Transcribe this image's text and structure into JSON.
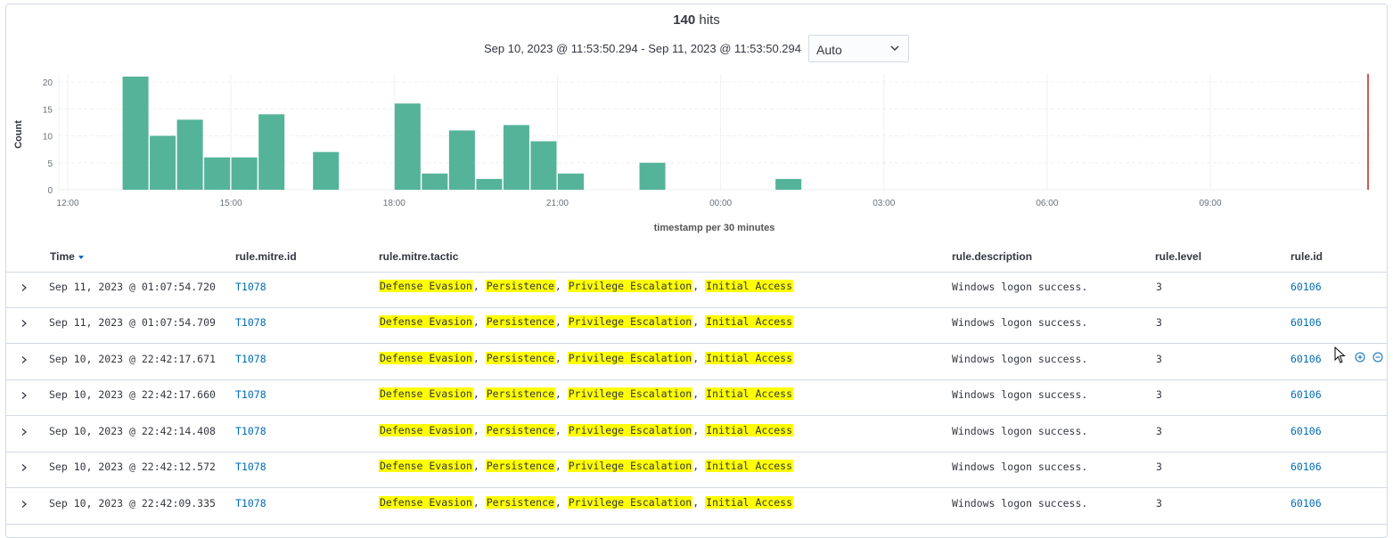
{
  "summary": {
    "hits_count": "140",
    "hits_label": "hits"
  },
  "time_range": "Sep 10, 2023 @ 11:53:50.294 - Sep 11, 2023 @ 11:53:50.294",
  "interval_select": {
    "value": "Auto"
  },
  "chart_data": {
    "type": "bar",
    "ylabel": "Count",
    "xlabel": "timestamp per 30 minutes",
    "ylim": [
      0,
      21
    ],
    "yticks": [
      0,
      5,
      10,
      15,
      20
    ],
    "xticks": [
      "12:00",
      "15:00",
      "18:00",
      "21:00",
      "00:00",
      "03:00",
      "06:00",
      "09:00"
    ],
    "x_start": "Sep 10, 2023 12:00",
    "bucket_minutes": 30,
    "bars": [
      {
        "start": "13:00",
        "value": 21
      },
      {
        "start": "13:30",
        "value": 10
      },
      {
        "start": "14:00",
        "value": 13
      },
      {
        "start": "14:30",
        "value": 6
      },
      {
        "start": "15:00",
        "value": 6
      },
      {
        "start": "15:30",
        "value": 14
      },
      {
        "start": "16:30",
        "value": 7
      },
      {
        "start": "18:00",
        "value": 16
      },
      {
        "start": "18:30",
        "value": 3
      },
      {
        "start": "19:00",
        "value": 11
      },
      {
        "start": "19:30",
        "value": 2
      },
      {
        "start": "20:00",
        "value": 12
      },
      {
        "start": "20:30",
        "value": 9
      },
      {
        "start": "21:00",
        "value": 3
      },
      {
        "start": "22:30",
        "value": 5
      },
      {
        "start": "01:00",
        "value": 2
      }
    ],
    "bar_color": "#54b399",
    "current_time_marker_color": "#bd271e",
    "grid": true
  },
  "table": {
    "columns": [
      "Time",
      "rule.mitre.id",
      "rule.mitre.tactic",
      "rule.description",
      "rule.level",
      "rule.id"
    ],
    "rows": [
      {
        "time": "Sep 11, 2023 @ 01:07:54.720",
        "mitre_id": "T1078",
        "tactics": [
          "Defense Evasion",
          "Persistence",
          "Privilege Escalation",
          "Initial Access"
        ],
        "description": "Windows logon success.",
        "level": "3",
        "rule_id": "60106"
      },
      {
        "time": "Sep 11, 2023 @ 01:07:54.709",
        "mitre_id": "T1078",
        "tactics": [
          "Defense Evasion",
          "Persistence",
          "Privilege Escalation",
          "Initial Access"
        ],
        "description": "Windows logon success.",
        "level": "3",
        "rule_id": "60106"
      },
      {
        "time": "Sep 10, 2023 @ 22:42:17.671",
        "mitre_id": "T1078",
        "tactics": [
          "Defense Evasion",
          "Persistence",
          "Privilege Escalation",
          "Initial Access"
        ],
        "description": "Windows logon success.",
        "level": "3",
        "rule_id": "60106"
      },
      {
        "time": "Sep 10, 2023 @ 22:42:17.660",
        "mitre_id": "T1078",
        "tactics": [
          "Defense Evasion",
          "Persistence",
          "Privilege Escalation",
          "Initial Access"
        ],
        "description": "Windows logon success.",
        "level": "3",
        "rule_id": "60106"
      },
      {
        "time": "Sep 10, 2023 @ 22:42:14.408",
        "mitre_id": "T1078",
        "tactics": [
          "Defense Evasion",
          "Persistence",
          "Privilege Escalation",
          "Initial Access"
        ],
        "description": "Windows logon success.",
        "level": "3",
        "rule_id": "60106"
      },
      {
        "time": "Sep 10, 2023 @ 22:42:12.572",
        "mitre_id": "T1078",
        "tactics": [
          "Defense Evasion",
          "Persistence",
          "Privilege Escalation",
          "Initial Access"
        ],
        "description": "Windows logon success.",
        "level": "3",
        "rule_id": "60106"
      },
      {
        "time": "Sep 10, 2023 @ 22:42:09.335",
        "mitre_id": "T1078",
        "tactics": [
          "Defense Evasion",
          "Persistence",
          "Privilege Escalation",
          "Initial Access"
        ],
        "description": "Windows logon success.",
        "level": "3",
        "rule_id": "60106"
      }
    ]
  },
  "icons": {
    "expand": "chevron-right-icon",
    "sort": "sort-down-icon",
    "filter_for": "plus-in-circle-icon",
    "filter_out": "minus-in-circle-icon"
  }
}
